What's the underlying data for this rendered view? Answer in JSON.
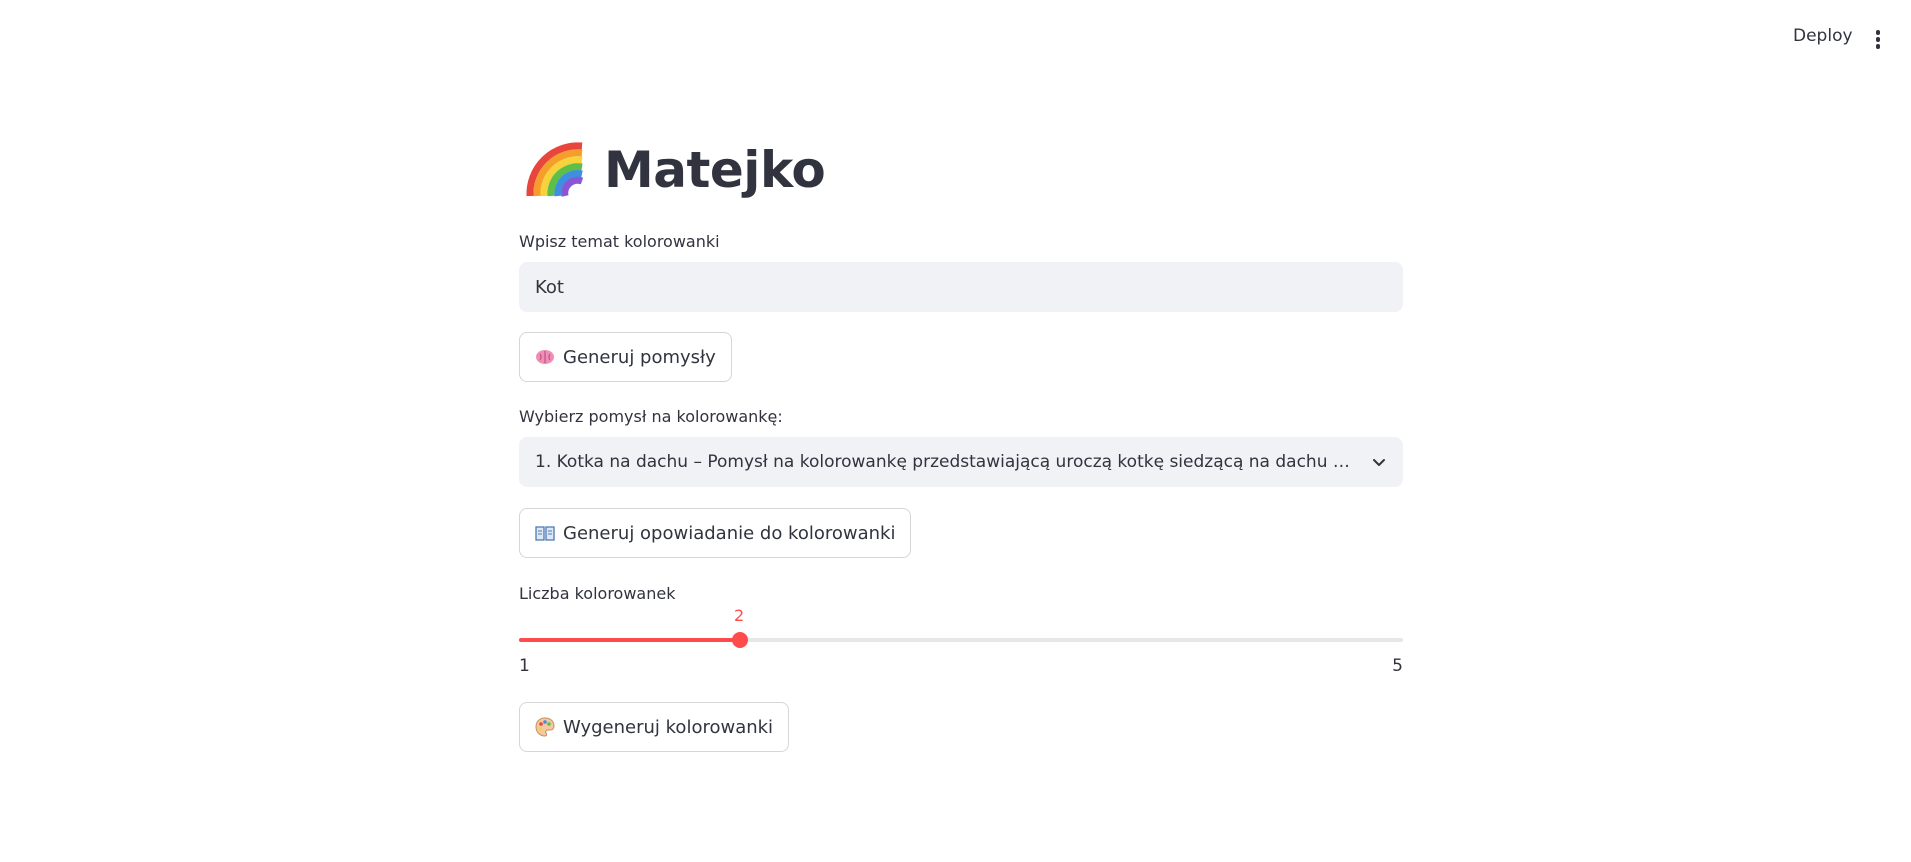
{
  "header": {
    "deploy_label": "Deploy",
    "menu_icon": "more-vertical-icon"
  },
  "app": {
    "title_icon": "rainbow-icon",
    "title": "Matejko"
  },
  "topic": {
    "label": "Wpisz temat kolorowanki",
    "value": "Kot"
  },
  "generate_ideas_button": {
    "icon": "brain-icon",
    "label": "Generuj pomysły"
  },
  "idea_select": {
    "label": "Wybierz pomysł na kolorowankę:",
    "selected": "1. Kotka na dachu – Pomysł na kolorowankę przedstawiającą uroczą kotkę siedzącą na dachu d…"
  },
  "story_button": {
    "icon": "book-icon",
    "label": "Generuj opowiadanie do kolorowanki"
  },
  "count_slider": {
    "label": "Liczba kolorowanek",
    "value": "2",
    "min": "1",
    "max": "5"
  },
  "generate_pages_button": {
    "icon": "palette-icon",
    "label": "Wygeneruj kolorowanki"
  },
  "colors": {
    "accent": "#ff4b4b",
    "text": "#31333f",
    "input_bg": "#f0f2f6"
  }
}
